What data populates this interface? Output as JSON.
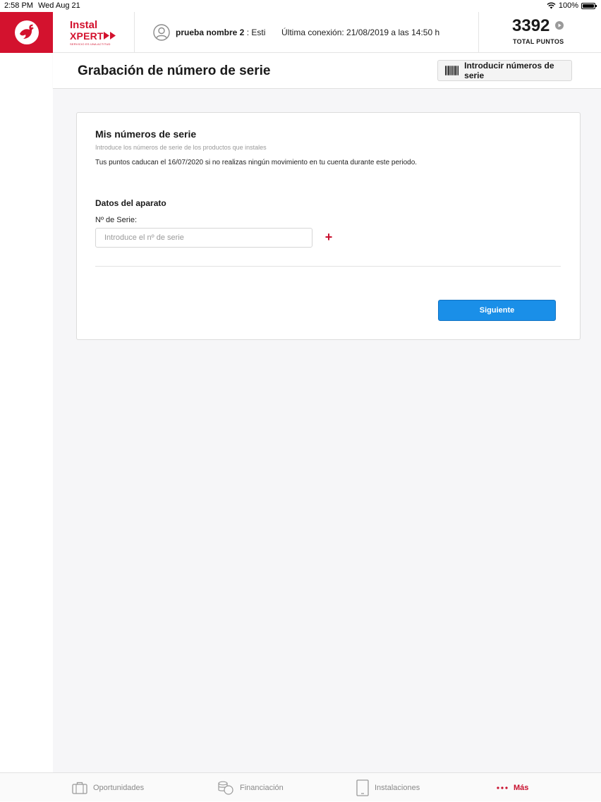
{
  "status_bar": {
    "time": "2:58 PM",
    "date": "Wed Aug 21",
    "battery": "100%"
  },
  "header": {
    "brand_line1": "Instal",
    "brand_line2": "XPERT",
    "brand_tagline": "SERVICIO ES UNA ACTITUD",
    "user_name": "prueba nombre 2",
    "user_suffix": " : Esti",
    "last_connection": "Última conexión: 21/08/2019 a las 14:50 h",
    "points_value": "3392",
    "points_label": "TOTAL PUNTOS"
  },
  "title_bar": {
    "title": "Grabación de número de serie",
    "serial_button_label": "Introducir números de serie"
  },
  "card": {
    "heading": "Mis números de serie",
    "subtitle": "Introduce los números de serie de los productos que instales",
    "note": "Tus puntos caducan el 16/07/2020 si no realizas ningún movimiento en tu cuenta durante este periodo.",
    "section_heading": "Datos del aparato",
    "serial_label": "Nº de Serie:",
    "serial_placeholder": "Introduce el nº de serie",
    "serial_value": "",
    "next_button_label": "Siguiente"
  },
  "tabs": [
    {
      "label": "Oportunidades",
      "icon": "briefcase-icon",
      "active": false
    },
    {
      "label": "Financiación",
      "icon": "coins-icon",
      "active": false
    },
    {
      "label": "Instalaciones",
      "icon": "tablet-icon",
      "active": false
    },
    {
      "label": "Más",
      "icon": "more-dots-icon",
      "active": true
    }
  ],
  "colors": {
    "brand_red": "#d3122e",
    "primary_blue": "#1a8fe8",
    "background_gray": "#f6f6f8"
  }
}
